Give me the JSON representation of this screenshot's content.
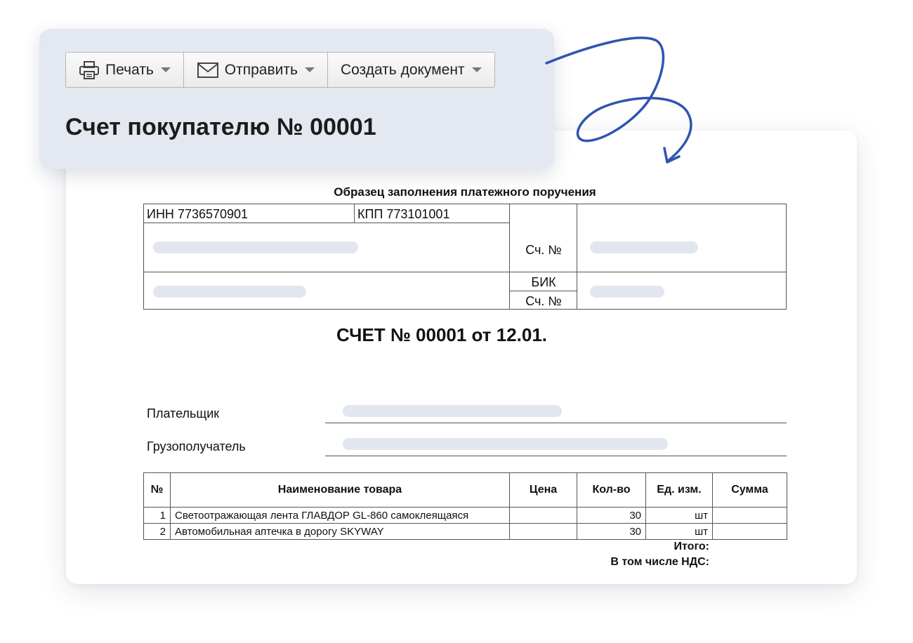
{
  "toolbar": {
    "print_label": "Печать",
    "send_label": "Отправить",
    "create_label": "Создать документ"
  },
  "panel": {
    "title": "Счет покупателю № 00001"
  },
  "document": {
    "sample_title": "Образец заполнения платежного поручения",
    "inn": "ИНН 7736570901",
    "kpp": "КПП 773101001",
    "account_label_1": "Сч. №",
    "bik_label": "БИК",
    "account_label_2": "Сч. №",
    "invoice_heading": "СЧЕТ № 00001 от 12.01.",
    "payer_label": "Плательщик",
    "consignee_label": "Грузополучатель",
    "table": {
      "headers": [
        "№",
        "Наименование товара",
        "Цена",
        "Кол-во",
        "Ед. изм.",
        "Сумма"
      ],
      "rows": [
        {
          "n": "1",
          "name": "Светоотражающая лента ГЛАВДОР GL-860 самоклеящаяся",
          "price": "",
          "qty": "30",
          "unit": "шт",
          "sum": ""
        },
        {
          "n": "2",
          "name": "Автомобильная аптечка в дорогу SKYWAY",
          "price": "",
          "qty": "30",
          "unit": "шт",
          "sum": ""
        }
      ]
    },
    "total_label": "Итого:",
    "vat_label": "В том числе НДС:"
  },
  "colors": {
    "panel_bg": "#e4e8f1",
    "arrow": "#2f55b0",
    "placeholder": "#e2e6ef"
  }
}
